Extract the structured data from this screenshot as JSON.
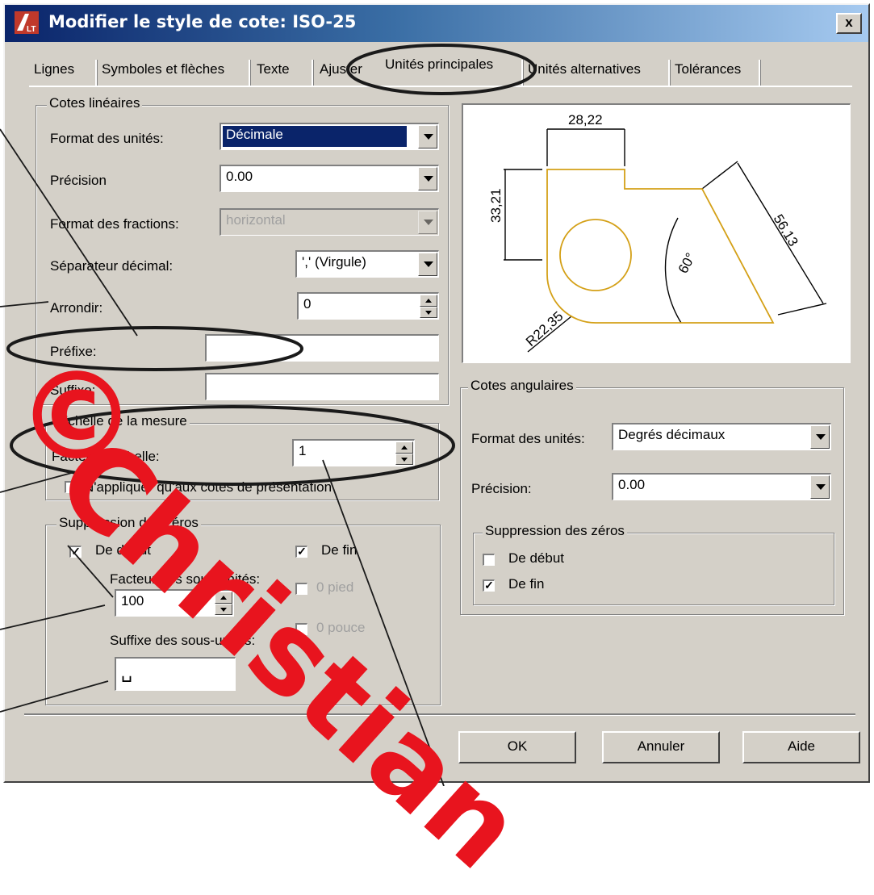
{
  "window": {
    "title": "Modifier le style de cote: ISO-25",
    "close_label": "x"
  },
  "tabs": [
    "Lignes",
    "Symboles et flèches",
    "Texte",
    "Ajuster",
    "Unités principales",
    "Unités alternatives",
    "Tolérances"
  ],
  "linear": {
    "group_title": "Cotes linéaires",
    "unit_format_label": "Format des unités:",
    "unit_format_value": "Décimale",
    "precision_label": "Précision",
    "precision_value": "0.00",
    "fraction_format_label": "Format des fractions:",
    "fraction_format_value": "horizontal",
    "decimal_separator_label": "Séparateur décimal:",
    "decimal_separator_value": "',' (Virgule)",
    "round_label": "Arrondir:",
    "round_value": "0",
    "prefix_label": "Préfixe:",
    "prefix_value": "",
    "suffix_label": "Suffixe:",
    "suffix_value": ""
  },
  "scale": {
    "group_title": "Echelle de la mesure",
    "factor_label": "Facteur d'échelle:",
    "factor_value": "1",
    "layout_only_label": "N'appliquer qu'aux cotes de présentation",
    "layout_only_checked": false
  },
  "zero_linear": {
    "group_title": "Suppression des zéros",
    "leading_label": "De début",
    "leading_checked": true,
    "trailing_label": "De fin",
    "trailing_checked": true,
    "subunit_factor_label": "Facteur des sous-unités:",
    "subunit_factor_value": "100",
    "subunit_suffix_label": "Suffixe des sous-unités:",
    "subunit_suffix_value": "␣",
    "feet_label": "0 pied",
    "inches_label": "0 pouce"
  },
  "angular": {
    "group_title": "Cotes angulaires",
    "unit_format_label": "Format des unités:",
    "unit_format_value": "Degrés décimaux",
    "precision_label": "Précision:",
    "precision_value": "0.00"
  },
  "zero_angular": {
    "group_title": "Suppression des zéros",
    "leading_label": "De début",
    "leading_checked": false,
    "trailing_label": "De fin",
    "trailing_checked": true
  },
  "preview": {
    "dim_top": "28,22",
    "dim_left": "33,21",
    "dim_diag": "56,13",
    "dim_angle": "60°",
    "dim_radius": "R22,35"
  },
  "buttons": {
    "ok": "OK",
    "cancel": "Annuler",
    "help": "Aide"
  },
  "watermark": {
    "copyright": "©",
    "name": "Christian"
  },
  "colors": {
    "annotation": "#1a1a1a",
    "watermark": "#e8141e",
    "part": "#d4a017"
  }
}
